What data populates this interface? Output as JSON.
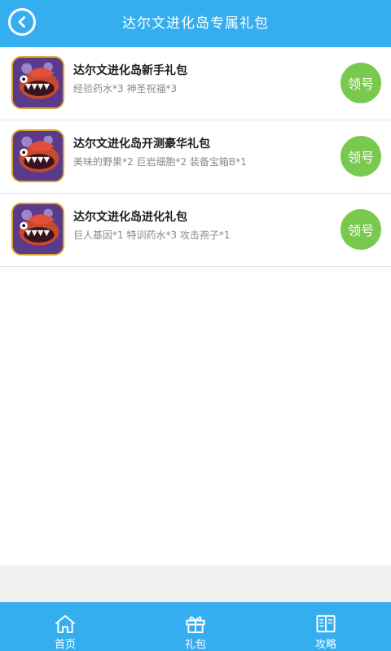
{
  "header": {
    "title": "达尔文进化岛专属礼包",
    "back_icon": "chevron-left-icon"
  },
  "gifts": [
    {
      "title": "达尔文进化岛新手礼包",
      "desc": "经验药水*3 神圣祝福*3",
      "button": "领号"
    },
    {
      "title": "达尔文进化岛开测豪华礼包",
      "desc": "美味的野果*2 巨岩细胞*2 装备宝箱B*1",
      "button": "领号"
    },
    {
      "title": "达尔文进化岛进化礼包",
      "desc": "巨人基因*1 特训药水*3 攻击孢子*1",
      "button": "领号"
    }
  ],
  "tabs": [
    {
      "label": "首页",
      "icon": "home-icon"
    },
    {
      "label": "礼包",
      "icon": "gift-icon"
    },
    {
      "label": "攻略",
      "icon": "book-icon"
    }
  ],
  "colors": {
    "primary": "#35aef0",
    "claim": "#7ac94f",
    "background_band": "#f0f0f0"
  }
}
